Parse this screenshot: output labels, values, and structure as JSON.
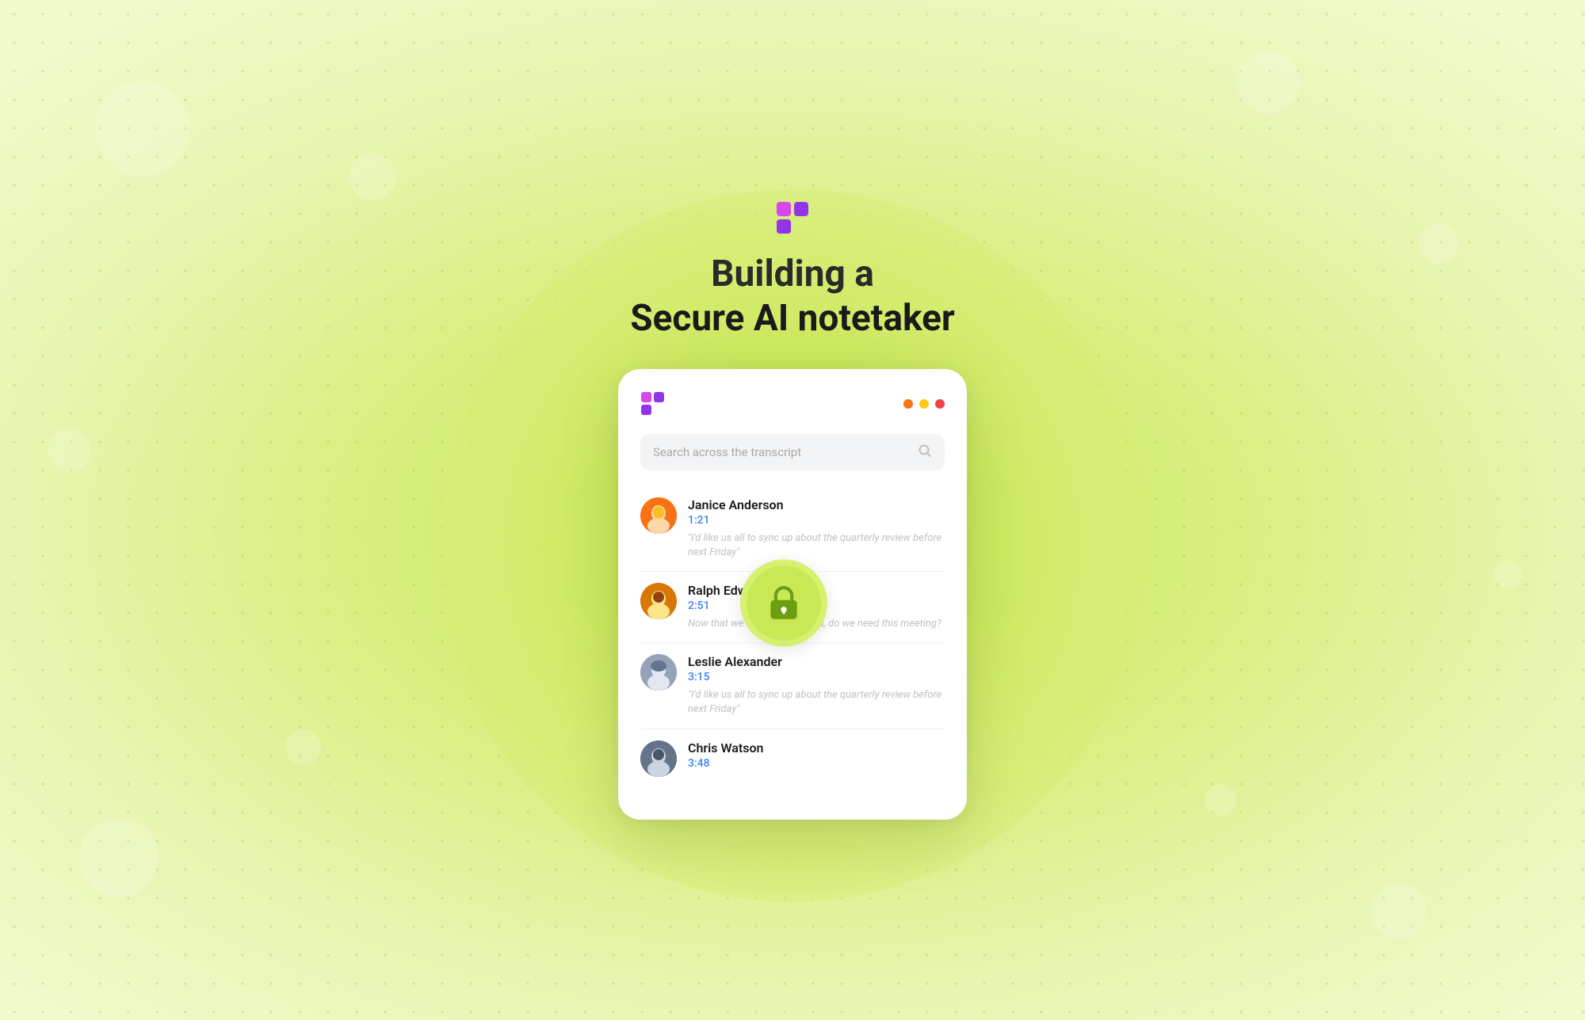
{
  "background": {
    "color": "#d4ed7a"
  },
  "heading": {
    "line1": "Building a",
    "line2": "Secure AI notetaker"
  },
  "logo": {
    "alt": "Taskade logo"
  },
  "traffic_lights": [
    {
      "color": "#f97316",
      "label": "dot-orange"
    },
    {
      "color": "#facc15",
      "label": "dot-yellow"
    },
    {
      "color": "#ef4444",
      "label": "dot-red"
    }
  ],
  "search": {
    "placeholder": "Search across the transcript"
  },
  "conversations": [
    {
      "id": "janice",
      "name": "Janice Anderson",
      "time": "1:21",
      "text": "\"I'd like us all to sync up about the quarterly review before next Friday\"",
      "avatar_emoji": "👩"
    },
    {
      "id": "ralph",
      "name": "Ralph Edwards",
      "time": "2:51",
      "text": "Now that we've set the agenda, do we need this meeting?",
      "avatar_emoji": "👨"
    },
    {
      "id": "leslie",
      "name": "Leslie Alexander",
      "time": "3:15",
      "text": "\"I'd like us all to sync up about the quarterly review before next Friday\"",
      "avatar_emoji": "👩"
    },
    {
      "id": "chris",
      "name": "Chris Watson",
      "time": "3:48",
      "text": "",
      "avatar_emoji": "👨"
    }
  ],
  "lock_icon": {
    "label": "security lock"
  }
}
